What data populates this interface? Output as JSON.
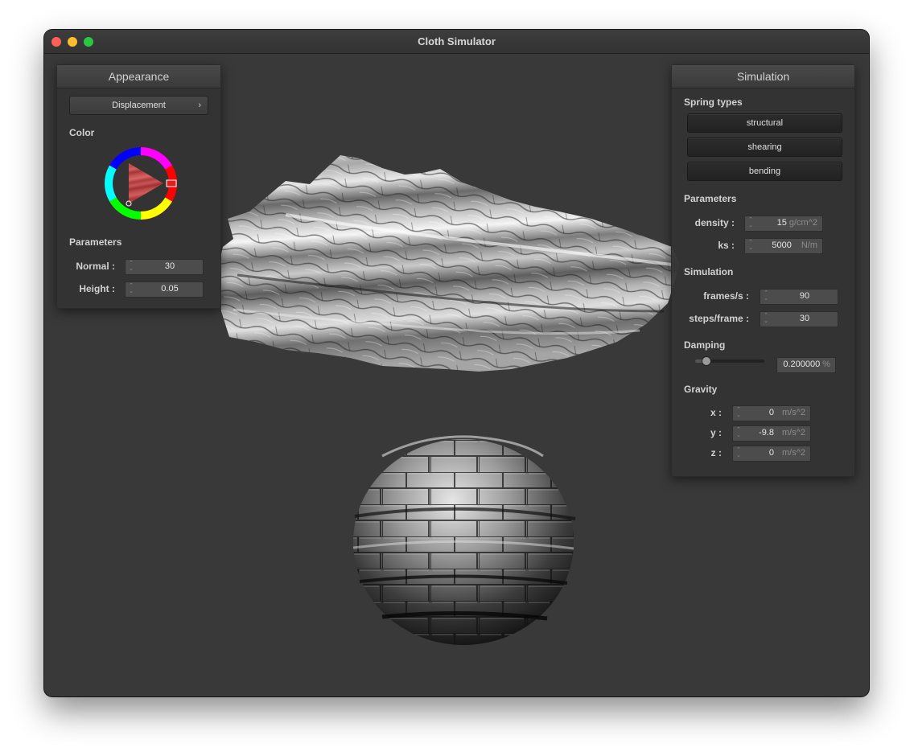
{
  "window": {
    "title": "Cloth Simulator"
  },
  "appearance": {
    "header": "Appearance",
    "shader_popup": "Displacement",
    "color_label": "Color",
    "parameters_label": "Parameters",
    "normal_label": "Normal :",
    "normal_value": "30",
    "height_label": "Height :",
    "height_value": "0.05"
  },
  "simulation": {
    "header": "Simulation",
    "spring_types_label": "Spring types",
    "spring_buttons": [
      "structural",
      "shearing",
      "bending"
    ],
    "parameters_label": "Parameters",
    "density_label": "density :",
    "density_value": "15",
    "density_unit": "g/cm^2",
    "ks_label": "ks :",
    "ks_value": "5000",
    "ks_unit": "N/m",
    "simulation_label": "Simulation",
    "fps_label": "frames/s :",
    "fps_value": "90",
    "steps_label": "steps/frame :",
    "steps_value": "30",
    "damping_label": "Damping",
    "damping_value": "0.200000",
    "damping_unit": "%",
    "damping_slider_level": 0.2,
    "gravity_label": "Gravity",
    "x_label": "x :",
    "x_value": "0",
    "y_label": "y :",
    "y_value": "-9.8",
    "z_label": "z :",
    "z_value": "0",
    "gravity_unit": "m/s^2"
  },
  "colors": {
    "window_bg": "#393939",
    "panel_bg": "#333333",
    "close": "#fe5f57",
    "minimize": "#febc2e",
    "maximize": "#28c840",
    "selected_color": "#e02020"
  }
}
